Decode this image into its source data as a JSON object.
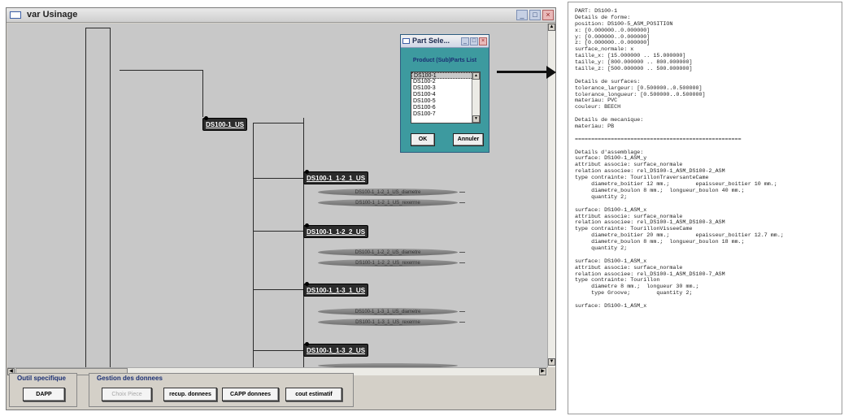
{
  "window": {
    "title": "var Usinage"
  },
  "tree": {
    "root": {
      "label": "DS100-1_US"
    },
    "nodes": [
      {
        "label": "DS100-1_1-2_1_US",
        "children": [
          "DS100-1_1-2_1_US_diametre",
          "DS100-1_1-2_1_US_rexerrne"
        ]
      },
      {
        "label": "DS100-1_1-2_2_US",
        "children": [
          "DS100-1_1-2_2_US_diametre",
          "DS100-1_1-2_2_US_rexerrne"
        ]
      },
      {
        "label": "DS100-1_1-3_1_US",
        "children": [
          "DS100-1_1-3_1_US_diametre",
          "DS100-1_1-3_1_US_rexerrne"
        ]
      },
      {
        "label": "DS100-1_1-3_2_US",
        "children": []
      }
    ]
  },
  "dialog": {
    "title": "Part Sele...",
    "label": "Product (Sub)Parts List",
    "items": [
      "DS100-1",
      "DS100-2",
      "DS100-3",
      "DS100-4",
      "DS100-5",
      "DS100-6",
      "DS100-7"
    ],
    "ok_label": "OK",
    "cancel_label": "Annuler"
  },
  "bottom": {
    "group1": {
      "label": "Outil specifique",
      "button": "DAPP"
    },
    "group2": {
      "label": "Gestion des donnees",
      "buttons": [
        "Choix Piece",
        "recup. donnees",
        "CAPP donnees",
        "cout estimatif"
      ]
    }
  },
  "panel": {
    "lines": [
      "PART: DS100-1",
      "Details de forme:",
      "position: DS100-5_ASM_POSITION",
      "x: [0.000000..0.000000]",
      "y: [0.000000..0.000000]",
      "z: [0.000000..0.000000]",
      "surface_normale: x",
      "taille_x: [15.000000 .. 15.000000]",
      "taille_y: [800.000000 .. 800.000000]",
      "taille_z: [500.000000 .. 500.000000]",
      "",
      "Details de surfaces:",
      "tolerance_largeur: [0.500000..0.500000]",
      "tolerance_longueur: [0.500000..0.500000]",
      "materiau: PVC",
      "couleur: BEECH",
      "",
      "Details de mecanique:",
      "materiau: PB",
      "",
      "===================================================",
      "",
      "Details d'assemblage:",
      "surface: DS100-1_ASM_y",
      "attribut associe: surface_normale",
      "relation associee: rel_DS100-1_ASM_DS100-2_ASM",
      "type contrainte: TourillonTraversanteCame",
      "     diametre_boitier 12 mm.;        epaisseur_boitier 10 mm.;",
      "     diametre_boulon 8 mm.;  longueur_boulon 40 mm.;",
      "     quantity 2;",
      "",
      "surface: DS100-1_ASM_x",
      "attribut associe: surface_normale",
      "relation associee: rel_DS100-1_ASM_DS100-3_ASM",
      "type contrainte: TourillonVisseeCame",
      "     diametre_boitier 20 mm.;        epaisseur_boitier 12.7 mm.;",
      "     diametre_boulon 8 mm.;  longueur_boulon 18 mm.;",
      "     quantity 2;",
      "",
      "surface: DS100-1_ASM_x",
      "attribut associe: surface_normale",
      "relation associee: rel_DS100-1_ASM_DS100-7_ASM",
      "type contrainte: Tourillon",
      "     diametre 8 mm.;  longueur 30 mm.;",
      "     type Groove;        quantity 2;",
      "",
      "surface: DS100-1_ASM_x"
    ]
  }
}
